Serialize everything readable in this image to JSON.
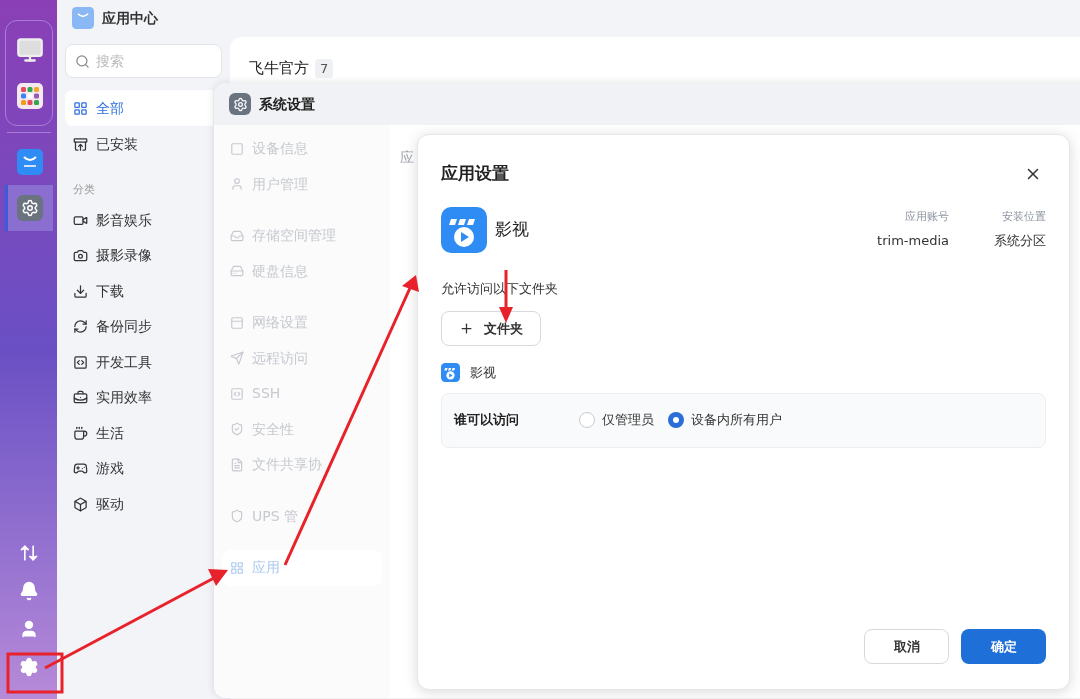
{
  "dock": {
    "apps": [
      {
        "kind": "monitor",
        "selected": false
      },
      {
        "kind": "grid",
        "selected": false
      },
      {
        "kind": "store",
        "selected": false
      },
      {
        "kind": "settings",
        "selected": true
      }
    ],
    "tools": [
      {
        "kind": "transfer"
      },
      {
        "kind": "bell"
      },
      {
        "kind": "user"
      },
      {
        "kind": "settings"
      }
    ]
  },
  "app_center": {
    "title": "应用中心",
    "search": {
      "placeholder": "搜索"
    },
    "nav": [
      {
        "label": "全部",
        "selected": true
      },
      {
        "label": "已安装",
        "selected": false
      }
    ],
    "category_heading": "分类",
    "categories": [
      "影音娱乐",
      "摄影录像",
      "下载",
      "备份同步",
      "开发工具",
      "实用效率",
      "生活",
      "游戏",
      "驱动"
    ],
    "section": {
      "title": "飞牛官方",
      "count": "7"
    }
  },
  "system_settings": {
    "title": "系统设置",
    "content_heading": "应",
    "menu_groups": [
      [
        {
          "label": "设备信息",
          "selected": false
        },
        {
          "label": "用户管理",
          "selected": false
        }
      ],
      [
        {
          "label": "存储空间管理",
          "selected": false
        },
        {
          "label": "硬盘信息",
          "selected": false
        }
      ],
      [
        {
          "label": "网络设置",
          "selected": false
        },
        {
          "label": "远程访问",
          "selected": false
        },
        {
          "label": "SSH",
          "selected": false
        },
        {
          "label": "安全性",
          "selected": false
        },
        {
          "label": "文件共享协",
          "selected": false
        }
      ],
      [
        {
          "label": "UPS 管",
          "selected": false
        }
      ],
      [
        {
          "label": "应用",
          "selected": true
        }
      ]
    ]
  },
  "dialog": {
    "title": "应用设置",
    "app_name": "影视",
    "meta": [
      {
        "label": "应用账号",
        "value": "trim-media"
      },
      {
        "label": "安装位置",
        "value": "系统分区"
      }
    ],
    "folders_label": "允许访问以下文件夹",
    "add_button": "文件夹",
    "folders": [
      {
        "name": "影视",
        "access_label": "谁可以访问",
        "options": [
          {
            "label": "仅管理员",
            "selected": false
          },
          {
            "label": "设备内所有用户",
            "selected": true
          }
        ]
      }
    ],
    "buttons": [
      {
        "label": "取消",
        "kind": "secondary"
      },
      {
        "label": "确定",
        "kind": "primary"
      }
    ]
  }
}
